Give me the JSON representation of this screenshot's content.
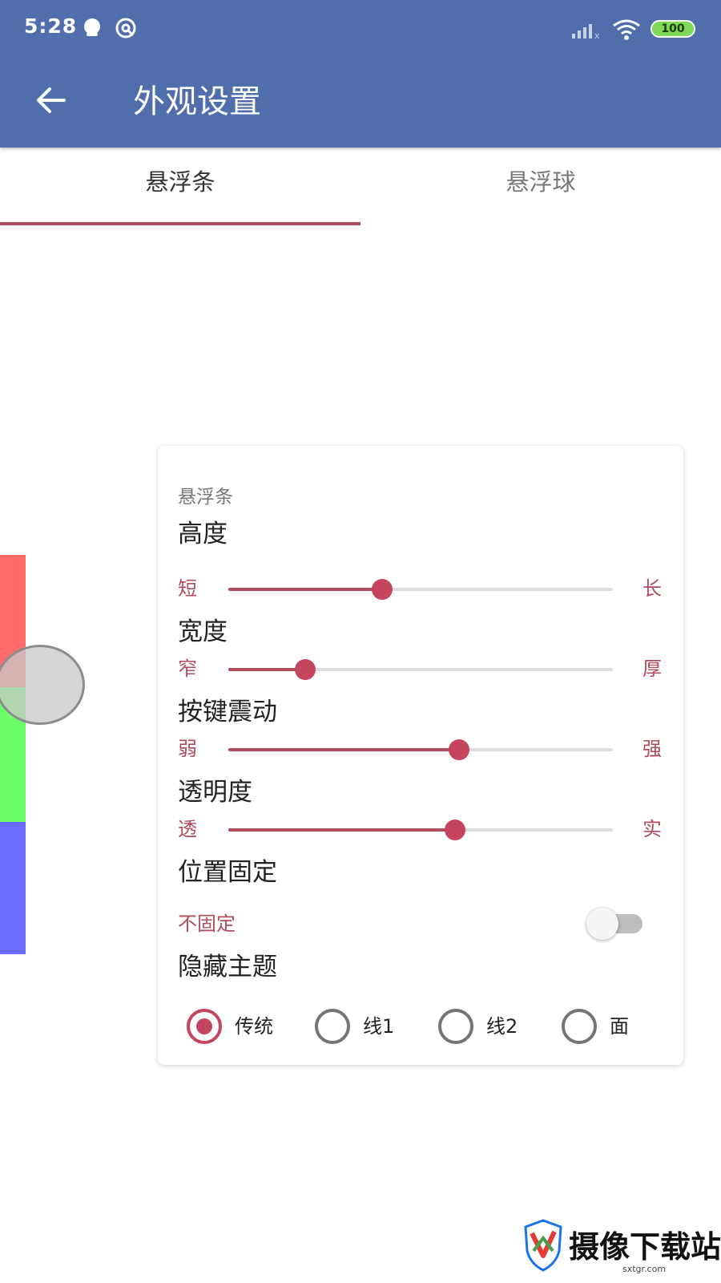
{
  "status_bar": {
    "time": "5:28",
    "battery": "100",
    "left_icons": [
      "chat-bubble-icon",
      "sync-icon"
    ],
    "right_icons": [
      "signal-icon",
      "wifi-icon",
      "battery-icon"
    ]
  },
  "app_bar": {
    "back_icon": "arrow-left-icon",
    "title": "外观设置",
    "color": "#4f6eab"
  },
  "tabs": [
    {
      "label": "悬浮条",
      "active": true
    },
    {
      "label": "悬浮球",
      "active": false
    }
  ],
  "preview": {
    "bar_colors": [
      "#ff6b6b",
      "#6bff6b",
      "#6b6bff"
    ],
    "ball_color": "#c8c8c8"
  },
  "card": {
    "title": "悬浮条",
    "accent": "#c4455e",
    "sliders": [
      {
        "label": "高度",
        "min_label": "短",
        "max_label": "长",
        "value": 0.4
      },
      {
        "label": "宽度",
        "min_label": "窄",
        "max_label": "厚",
        "value": 0.2
      },
      {
        "label": "按键震动",
        "min_label": "弱",
        "max_label": "强",
        "value": 0.6
      },
      {
        "label": "透明度",
        "min_label": "透",
        "max_label": "实",
        "value": 0.59
      }
    ],
    "position_fixed": {
      "label": "位置固定",
      "description": "不固定",
      "on": false
    },
    "hide_theme": {
      "label": "隐藏主题",
      "options": [
        "传统",
        "线1",
        "线2",
        "面"
      ],
      "selected": "传统"
    }
  },
  "watermark": {
    "text": "摄像下载站",
    "subtext": "sxtgr.com"
  }
}
